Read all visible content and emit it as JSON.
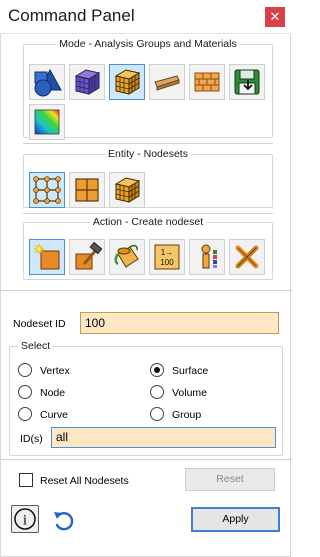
{
  "window": {
    "title": "Command Panel",
    "close_glyph": "✕"
  },
  "mode": {
    "legend": "Mode - Analysis Groups and Materials",
    "buttons": [
      {
        "icon": "geometry-shapes-icon",
        "active": false
      },
      {
        "icon": "mesh-cube-icon",
        "active": false
      },
      {
        "icon": "hex-block-cube-icon",
        "active": true
      },
      {
        "icon": "beam-element-icon",
        "active": false
      },
      {
        "icon": "brick-material-icon",
        "active": false
      },
      {
        "icon": "save-floppy-icon",
        "active": false
      },
      {
        "icon": "contour-results-icon",
        "active": false
      }
    ]
  },
  "entity": {
    "legend": "Entity - Nodesets",
    "buttons": [
      {
        "icon": "vertex-grid-icon",
        "active": true
      },
      {
        "icon": "surface-grid-icon",
        "active": false
      },
      {
        "icon": "volume-cube-icon",
        "active": false
      }
    ]
  },
  "action": {
    "legend": "Action - Create nodeset",
    "buttons": [
      {
        "icon": "create-sparkle-icon",
        "active": true
      },
      {
        "icon": "modify-hammer-icon",
        "active": false
      },
      {
        "icon": "paint-bucket-icon",
        "active": false
      },
      {
        "icon": "renumber-icon",
        "active": false
      },
      {
        "icon": "list-info-icon",
        "active": false
      },
      {
        "icon": "delete-tools-icon",
        "active": false
      }
    ],
    "renumber_text_top": "1→",
    "renumber_text_bottom": "100"
  },
  "nodeset": {
    "label": "Nodeset ID",
    "value": "100"
  },
  "select": {
    "legend": "Select",
    "options": [
      {
        "label": "Vertex",
        "checked": false
      },
      {
        "label": "Surface",
        "checked": true
      },
      {
        "label": "Node",
        "checked": false
      },
      {
        "label": "Volume",
        "checked": false
      },
      {
        "label": "Curve",
        "checked": false
      },
      {
        "label": "Group",
        "checked": false
      }
    ],
    "ids_label": "ID(s)",
    "ids_value": "all"
  },
  "reset": {
    "checkbox_label": "Reset All Nodesets",
    "button_label": "Reset"
  },
  "footer": {
    "info_glyph": "i",
    "apply_label": "Apply"
  },
  "colors": {
    "active_button": "#cfe7fb",
    "input_background": "#fde7c5",
    "close_button": "#d8414a",
    "apply_border": "#3d7fd1"
  }
}
